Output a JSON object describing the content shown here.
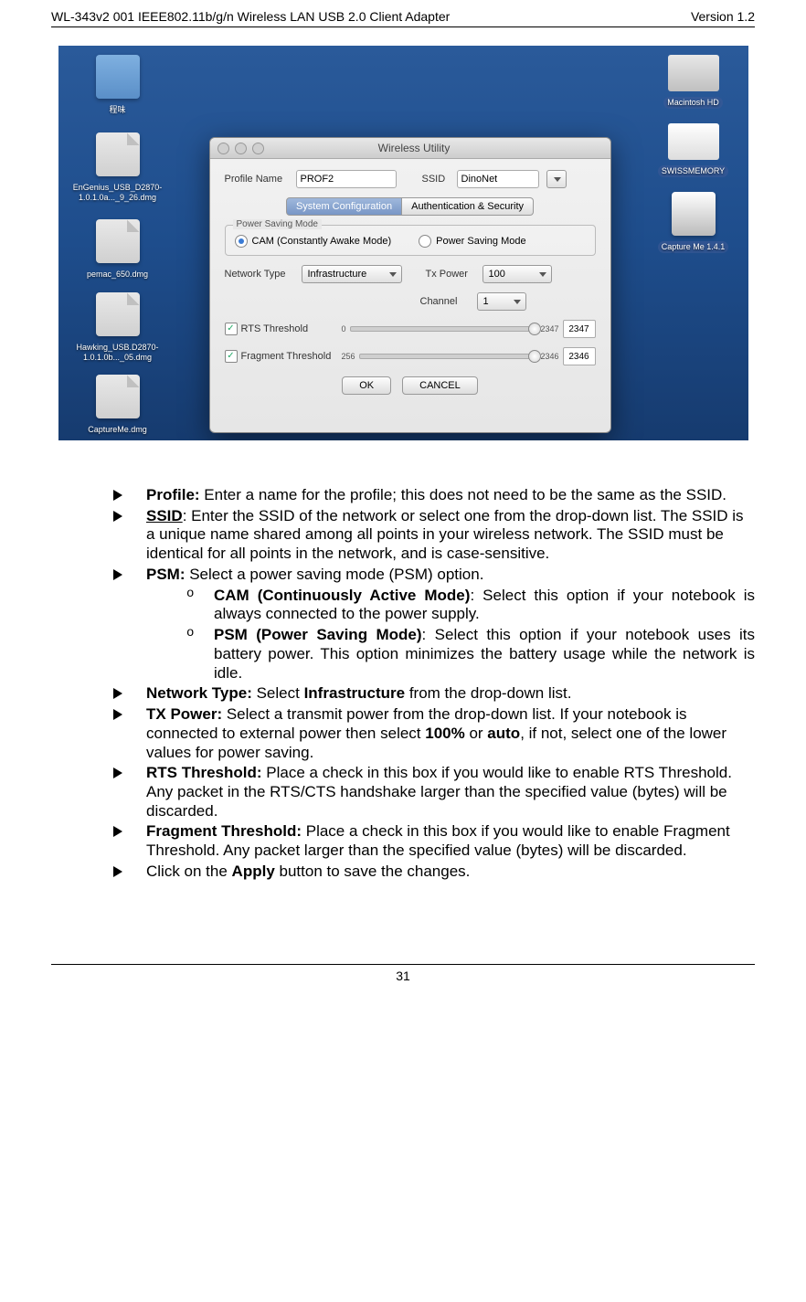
{
  "header": {
    "left": "WL-343v2 001 IEEE802.11b/g/n Wireless LAN USB 2.0 Client Adapter",
    "right": "Version 1.2"
  },
  "screenshot": {
    "desktop_icons_left": [
      {
        "name": "folder-1",
        "label": "程味",
        "type": "folder"
      },
      {
        "name": "dmg-engenius",
        "label": "EnGenius_USB_D2870-1.0.1.0a..._9_26.dmg",
        "type": "dmg"
      },
      {
        "name": "dmg-pemac",
        "label": "pemac_650.dmg",
        "type": "dmg"
      },
      {
        "name": "dmg-hawking",
        "label": "Hawking_USB.D2870-1.0.1.0b..._05.dmg",
        "type": "dmg"
      },
      {
        "name": "dmg-captureme",
        "label": "CaptureMe.dmg",
        "type": "dmg"
      }
    ],
    "desktop_icons_right": [
      {
        "name": "drive-macintosh",
        "label": "Macintosh HD",
        "type": "drive"
      },
      {
        "name": "drive-swiss",
        "label": "SWISSMEMORY",
        "type": "drive"
      },
      {
        "name": "app-captureme",
        "label": "Capture Me 1.4.1",
        "type": "app"
      }
    ],
    "window": {
      "title": "Wireless Utility",
      "profile_name_label": "Profile Name",
      "profile_name_value": "PROF2",
      "ssid_label": "SSID",
      "ssid_value": "DinoNet",
      "tabs": {
        "sys": "System Configuration",
        "auth": "Authentication & Security"
      },
      "psm_group_label": "Power Saving Mode",
      "radio_cam": "CAM (Constantly Awake Mode)",
      "radio_psm": "Power Saving Mode",
      "network_type_label": "Network Type",
      "network_type_value": "Infrastructure",
      "tx_power_label": "Tx Power",
      "tx_power_value": "100",
      "channel_label": "Channel",
      "channel_value": "1",
      "rts_label": "RTS Threshold",
      "rts_min": "0",
      "rts_max": "2347",
      "rts_value": "2347",
      "frag_label": "Fragment Threshold",
      "frag_min": "256",
      "frag_max": "2346",
      "frag_value": "2346",
      "ok_button": "OK",
      "cancel_button": "CANCEL"
    }
  },
  "bullets": {
    "profile": {
      "label": "Profile:",
      "text": " Enter a name for the profile; this does not need to be the same as the SSID."
    },
    "ssid": {
      "label": "SSID",
      "text": ": Enter the SSID of the network or select one from the drop-down list. The SSID is a unique name shared among all points in your wireless network. The SSID must be identical for all points in the network, and is case-sensitive."
    },
    "psm": {
      "label": "PSM:",
      "text": " Select a power saving mode (PSM) option.",
      "sub_cam_label": "CAM (Continuously Active Mode)",
      "sub_cam_text": ": Select this option if your notebook is always connected to the power supply.",
      "sub_psm_label": "PSM (Power Saving Mode)",
      "sub_psm_text": ": Select this option if your notebook uses its battery power. This option minimizes the battery usage while the network is idle."
    },
    "network": {
      "label": "Network Type:",
      "text_pre": " Select ",
      "bold": "Infrastructure",
      "text_post": " from the drop-down list."
    },
    "tx": {
      "label": "TX Power:",
      "text_pre": " Select a transmit power from the drop-down list. If your notebook is connected to external power then select ",
      "bold1": "100%",
      "mid": " or ",
      "bold2": "auto",
      "text_post": ", if not, select one of the lower values for power saving."
    },
    "rts": {
      "label": "RTS Threshold:",
      "text": " Place a check in this box if you would like to enable RTS Threshold. Any packet in the RTS/CTS handshake larger than the specified value (bytes) will be discarded."
    },
    "frag": {
      "label": "Fragment Threshold:",
      "text": " Place a check in this box if you would like to enable Fragment Threshold. Any packet larger than the specified value (bytes) will be discarded."
    },
    "apply": {
      "text_pre": "Click on the ",
      "bold": "Apply",
      "text_post": " button to save the changes."
    }
  },
  "footer": {
    "page": "31"
  }
}
